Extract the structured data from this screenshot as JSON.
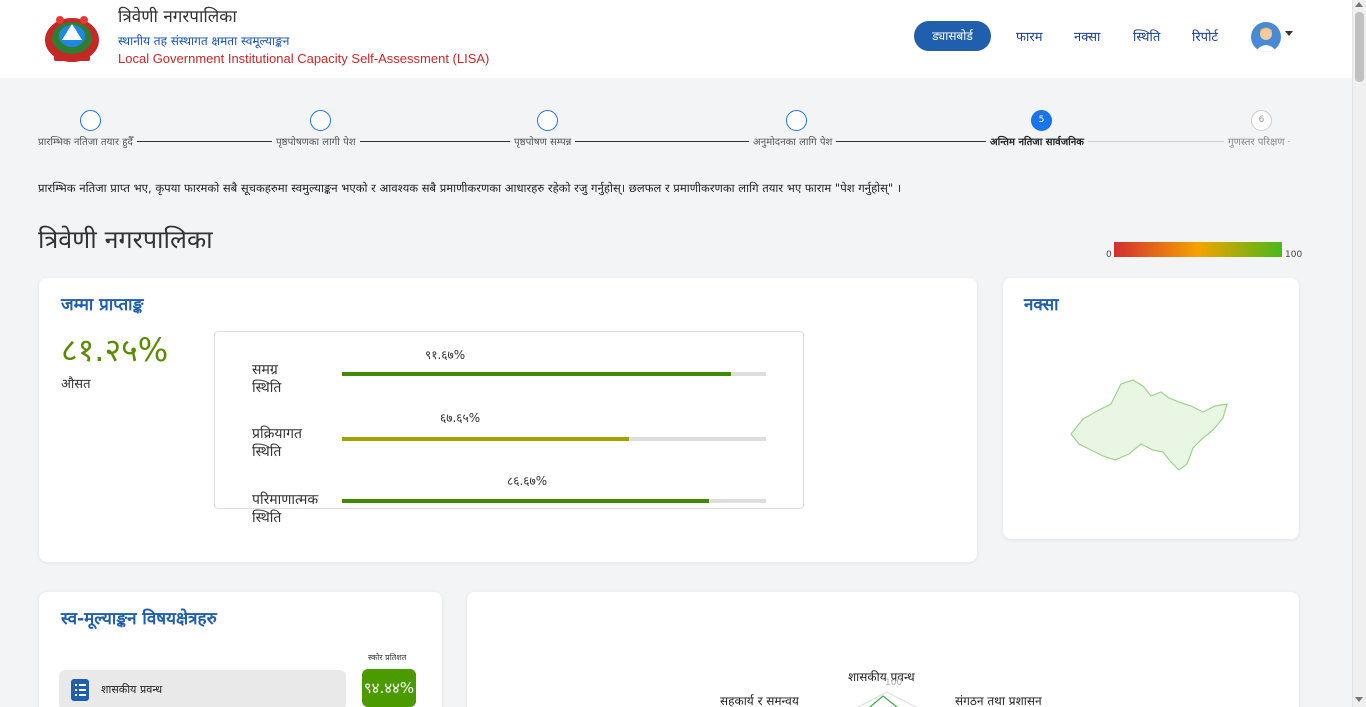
{
  "header": {
    "title": "त्रिवेणी नगरपालिका",
    "subtitle": "स्थानीय तह संस्थागत क्षमता स्वमूल्याङ्कन",
    "english_title": "Local Government Institutional Capacity Self-Assessment (LISA)"
  },
  "nav": {
    "dashboard": "ड्यासबोर्ड",
    "form": "फारम",
    "map": "नक्सा",
    "status": "स्थिति",
    "report": "रिपोर्ट"
  },
  "stepper": {
    "steps": [
      {
        "label": "प्रारम्भिक नतिजा तयार हुदैँ",
        "number": ""
      },
      {
        "label": "पृष्ठपोषणका लागी पेश",
        "number": ""
      },
      {
        "label": "पृष्ठपोषण सम्पन्न",
        "number": ""
      },
      {
        "label": "अनुमोदनका लागि पेश",
        "number": ""
      },
      {
        "label": "अन्तिम नतिजा सार्वजनिक",
        "number": "5"
      },
      {
        "label": "गुणस्तर परिक्षण",
        "number": "6"
      }
    ]
  },
  "notice": "प्रारम्भिक नतिजा प्राप्त भए, कृपया फारमको सबै सूचकहरुमा स्वमुल्याङ्कन भएको र आवश्यक सबै प्रमाणीकरणका आधारहरु रहेको रजु गर्नुहोस्। छलफल र प्रमाणीकरणका लागि तयार भए फाराम \"पेश गर्नुहोस्\" ।",
  "municipality": "त्रिवेणी नगरपालिका",
  "scale": {
    "min": "0",
    "max": "100",
    "colors": [
      "#d32f2f",
      "#f4a300",
      "#49b819"
    ]
  },
  "total_score": {
    "title": "जम्मा प्राप्ताङ्क",
    "value": "८१.२५%",
    "caption": "औसत",
    "bars": [
      {
        "label_line1": "समग्र",
        "label_line2": "स्थिति",
        "value_text": "९१.६७%",
        "value": 91.67,
        "color": "#3f8a00"
      },
      {
        "label_line1": "प्रक्रियागत",
        "label_line2": "स्थिति",
        "value_text": "६७.६५%",
        "value": 67.65,
        "color": "#a3a000"
      },
      {
        "label_line1": "परिमाणात्मक",
        "label_line2": "स्थिति",
        "value_text": "८६.६७%",
        "value": 86.67,
        "color": "#3f8a00"
      }
    ]
  },
  "map_card": {
    "title": "नक्सा",
    "fill": "#eaf6e4",
    "stroke": "#9bd48a"
  },
  "assessment": {
    "title": "स्व-मूल्याङ्कन विषयक्षेत्रहरु",
    "percent_header": "स्कोर प्रतिशत",
    "rows": [
      {
        "label": "शासकीय प्रवन्ध",
        "score": "९४.४४%"
      }
    ]
  },
  "radar": {
    "labels": [
      "शासकीय प्रवन्ध",
      "सहकार्य र समन्वय",
      "संगठन तथा प्रशासन"
    ],
    "tick": "100"
  }
}
